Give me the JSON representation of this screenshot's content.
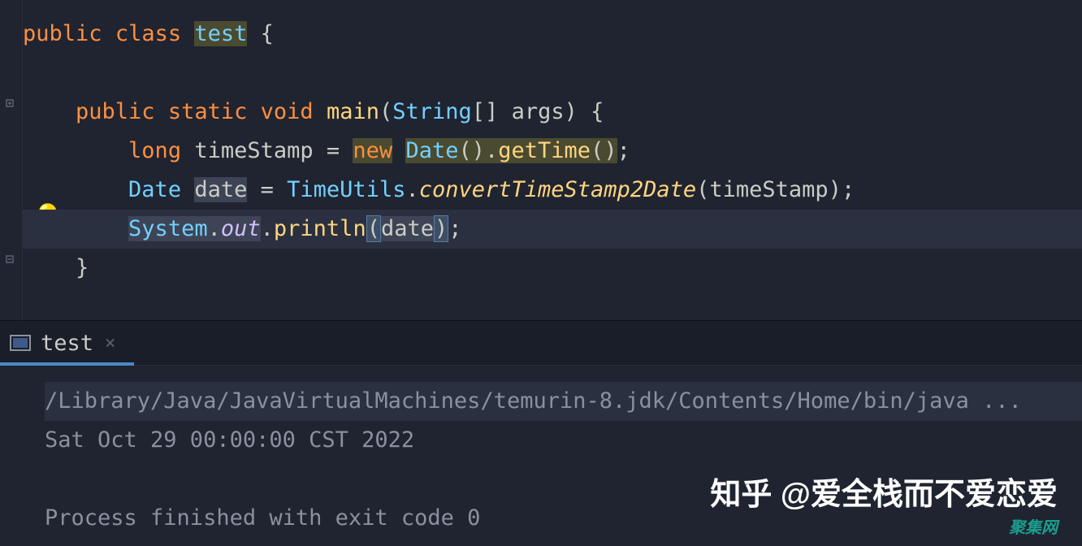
{
  "code": {
    "line1": {
      "public": "public",
      "class": "class",
      "name": "test",
      "brace": " {"
    },
    "line3": {
      "indent": "    ",
      "public": "public",
      "static": "static",
      "void": "void",
      "main": "main",
      "lparen": "(",
      "string": "String",
      "brackets": "[]",
      "args": " args",
      "rparen": ")",
      "brace": " {"
    },
    "line4": {
      "indent": "        ",
      "long": "long",
      "var": " timeStamp ",
      "eq": "= ",
      "new": "new",
      "sp": " ",
      "date": "Date",
      "parens": "()",
      "dot": ".",
      "getTime": "getTime",
      "parens2": "()",
      "semi": ";"
    },
    "line5": {
      "indent": "        ",
      "date": "Date",
      "var": " date ",
      "eq": "= ",
      "util": "TimeUtils",
      "dot": ".",
      "convert": "convertTimeStamp2Date",
      "lparen": "(",
      "arg": "timeStamp",
      "rparen": ")",
      "semi": ";"
    },
    "line6": {
      "indent": "        ",
      "system": "System",
      "dot1": ".",
      "out": "out",
      "dot2": ".",
      "println": "println",
      "lparen": "(",
      "arg": "date",
      "rparen": ")",
      "semi": ";"
    },
    "line7": {
      "indent": "    ",
      "brace": "}"
    }
  },
  "tab": {
    "label": "test",
    "close": "×"
  },
  "console": {
    "path": "/Library/Java/JavaVirtualMachines/temurin-8.jdk/Contents/Home/bin/java ...",
    "output": "Sat Oct 29 00:00:00 CST 2022",
    "exit": "Process finished with exit code 0"
  },
  "watermark": {
    "main": "知乎 @爱全栈而不爱恋爱",
    "sub": "聚集网"
  }
}
